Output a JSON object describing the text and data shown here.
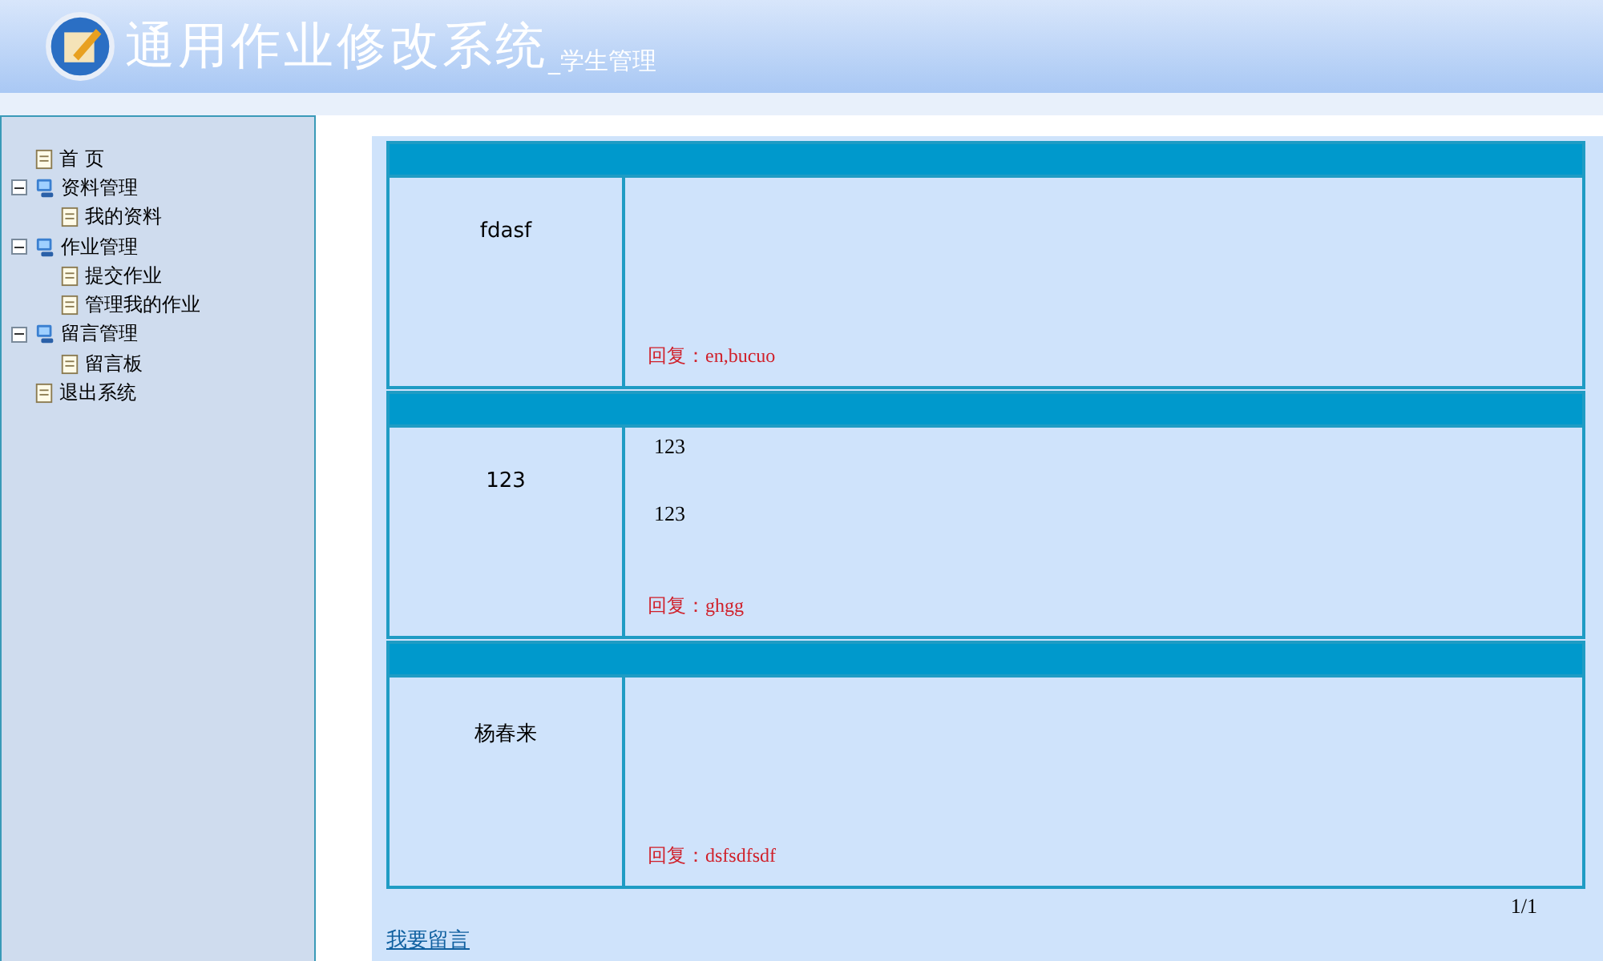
{
  "header": {
    "title": "通用作业修改系统",
    "subtitle": "_学生管理"
  },
  "sidebar": {
    "items": [
      {
        "label": "首 页",
        "kind": "page"
      },
      {
        "label": "资料管理",
        "kind": "folder",
        "expanded": true,
        "children": [
          {
            "label": "我的资料",
            "kind": "page"
          }
        ]
      },
      {
        "label": "作业管理",
        "kind": "folder",
        "expanded": true,
        "children": [
          {
            "label": "提交作业",
            "kind": "page"
          },
          {
            "label": "管理我的作业",
            "kind": "page"
          }
        ]
      },
      {
        "label": "留言管理",
        "kind": "folder",
        "expanded": true,
        "children": [
          {
            "label": "留言板",
            "kind": "page"
          }
        ]
      },
      {
        "label": "退出系统",
        "kind": "page"
      }
    ]
  },
  "messages": [
    {
      "author": "fdasf",
      "reply": "回复：en,bucuo"
    },
    {
      "author": "123",
      "lines": [
        "123",
        "123"
      ],
      "reply": "回复：ghgg"
    },
    {
      "author": "杨春来",
      "reply": "回复：dsfsdfsdf"
    }
  ],
  "pager": "1/1",
  "leave_message_link": "我要留言"
}
